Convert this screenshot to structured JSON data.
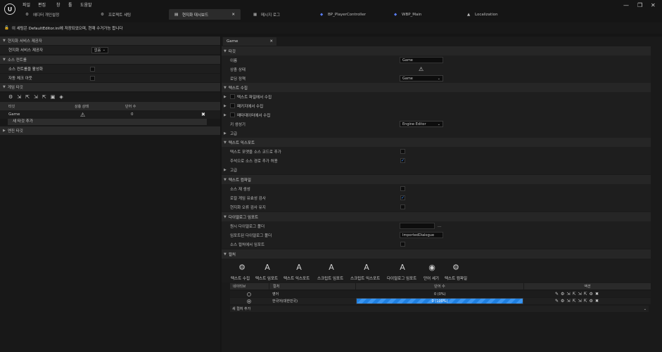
{
  "menu": [
    "파일",
    "편집",
    "창",
    "툴",
    "도움말"
  ],
  "tabs": [
    {
      "label": "에디터 개인설정"
    },
    {
      "label": "프로젝트 세팅"
    },
    {
      "label": "현지화 대시보드"
    },
    {
      "label": "메시지 로그"
    },
    {
      "label": "BP_PlayerController"
    },
    {
      "label": "WBP_Main"
    },
    {
      "label": "Localization"
    }
  ],
  "notice": "이 세팅은 DefaultEditor.ini에 저장되었으며, 현재 수거가능 합니다",
  "left": {
    "sec_service": "현지화 서비스 제공자",
    "service_provider_label": "현지화 서비스 제공자",
    "service_provider_value": "없음",
    "sec_source": "소스 컨트롤",
    "source_enable": "소스 컨트롤을 활성화",
    "auto_add": "자동 체크 아웃",
    "sec_targets": "게임 타깃",
    "col_target": "타깃",
    "col_status": "상충 상태",
    "col_words": "단어 수",
    "row_name": "Game",
    "row_words": "0",
    "add_target": "새 타깃 추가",
    "sec_engine": "엔진 타깃"
  },
  "right": {
    "tab_label": "Game",
    "sec_target": "타깃",
    "name_label": "이름",
    "name_value": "Game",
    "conflict_label": "상충 상태",
    "load_label": "로딩 정책",
    "load_value": "Game",
    "sec_gather": "텍스트 수집",
    "gather_ini": "텍스트 파일에서 수집",
    "gather_pkg": "패키지에서 수집",
    "gather_meta": "메타데이터에서 수집",
    "generator_label": "키 생성기",
    "generator_value": "Engine Editor",
    "advanced": "고급",
    "sec_export": "텍스트 익스포트",
    "export_1": "텍스트 포맷을 소스 코드로 추가",
    "export_2": "주석으로 소스 경로 추가 허용",
    "sec_compile": "텍스트 컴파일",
    "compile_1": "소스 재 생성",
    "compile_2": "로컬 게임 유효성 검사",
    "compile_3": "현지화 오류 검사 유지",
    "sec_dialogue": "다이얼로그 임포트",
    "dialogue_1": "원시 다이얼로그 폴더",
    "dialogue_2": "임포트된 다이얼로그 폴더",
    "dialogue_2_value": "ImportedDialogue",
    "dialogue_3": "소스 컬처에서 임포트",
    "sec_cultures": "컬처",
    "tools": [
      "텍스트 수집",
      "텍스트 임포트",
      "텍스트 익스포트",
      "스크립트 임포트",
      "스크립트 익스포트",
      "다이얼로그 임포트",
      "단어 세기",
      "텍스트 컴파일"
    ],
    "col_native": "네이티브",
    "col_culture": "컬처",
    "col_wordcount": "단어 수",
    "col_actions": "액션",
    "cultures": [
      {
        "name": "영어",
        "count": "0 (0%)",
        "progress": 0,
        "native": false
      },
      {
        "name": "한국어(대한민국)",
        "count": "0 (100%)",
        "progress": 1.0,
        "native": true
      }
    ],
    "add_culture": "새 컬처 추가"
  },
  "colors": {
    "accent": "#1f7fe0",
    "check": "#3a8dff",
    "warning": "#e0e0e0"
  }
}
